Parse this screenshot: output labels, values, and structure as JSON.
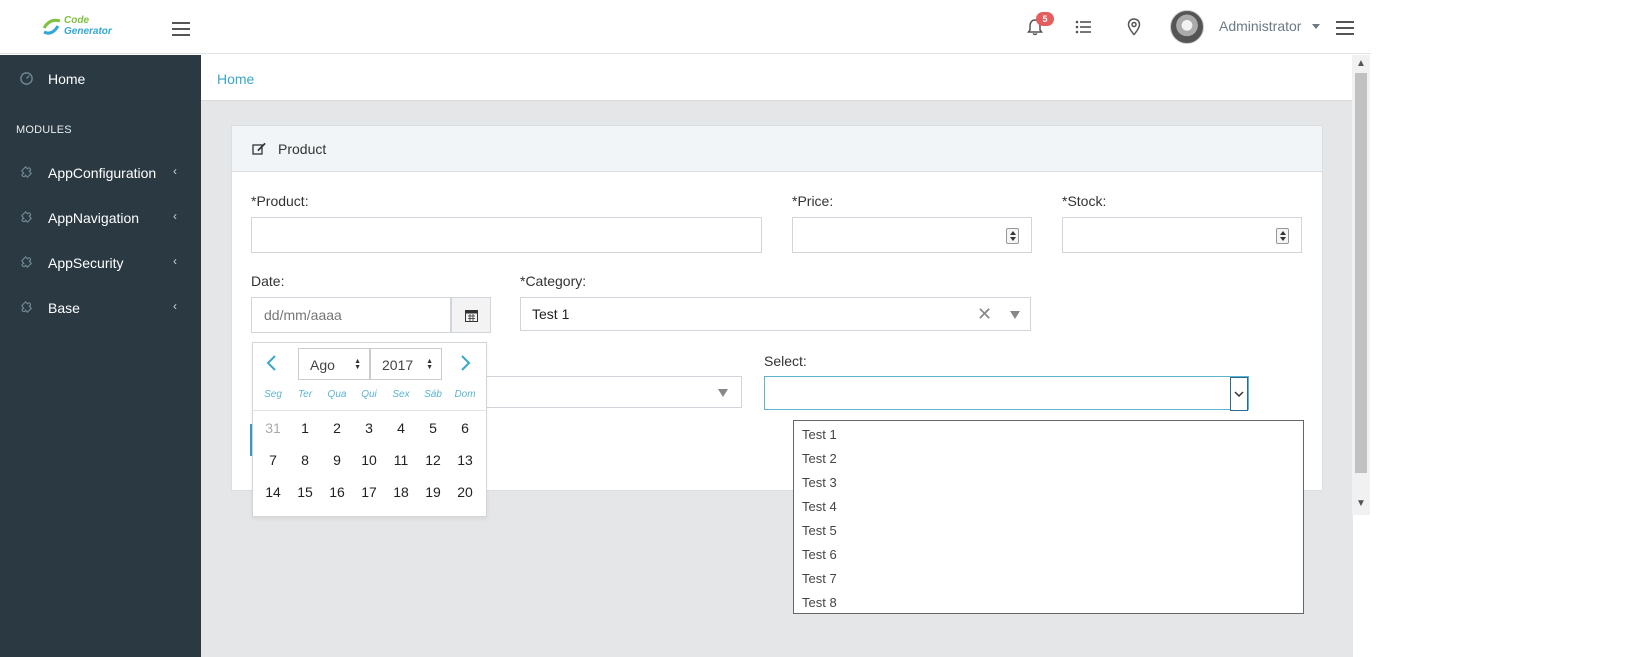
{
  "header": {
    "logo": {
      "line1": "Code",
      "line2": "Generator"
    },
    "notification_count": "5",
    "user_name": "Administrator"
  },
  "sidebar": {
    "home": "Home",
    "section_label": "MODULES",
    "items": [
      {
        "label": "AppConfiguration"
      },
      {
        "label": "AppNavigation"
      },
      {
        "label": "AppSecurity"
      },
      {
        "label": "Base"
      }
    ]
  },
  "breadcrumb": {
    "home": "Home"
  },
  "form": {
    "title": "Product",
    "product_label": "*Product:",
    "price_label": "*Price:",
    "stock_label": "*Stock:",
    "date_label": "Date:",
    "date_placeholder": "dd/mm/aaaa",
    "category_label": "*Category:",
    "category_value": "Test 1",
    "select_label": "Select:",
    "select_options": [
      "Test 1",
      "Test 2",
      "Test 3",
      "Test 4",
      "Test 5",
      "Test 6",
      "Test 7",
      "Test 8"
    ]
  },
  "datepicker": {
    "month": "Ago",
    "year": "2017",
    "weekdays": [
      "Seg",
      "Ter",
      "Qua",
      "Qui",
      "Sex",
      "Sáb",
      "Dom"
    ],
    "weeks": [
      [
        "31",
        "1",
        "2",
        "3",
        "4",
        "5",
        "6"
      ],
      [
        "7",
        "8",
        "9",
        "10",
        "11",
        "12",
        "13"
      ],
      [
        "14",
        "15",
        "16",
        "17",
        "18",
        "19",
        "20"
      ]
    ]
  },
  "colors": {
    "sidebar_bg": "#2a3942",
    "accent": "#3aa6c9",
    "badge": "#e55e5e",
    "content_bg": "#e5e6e7"
  }
}
